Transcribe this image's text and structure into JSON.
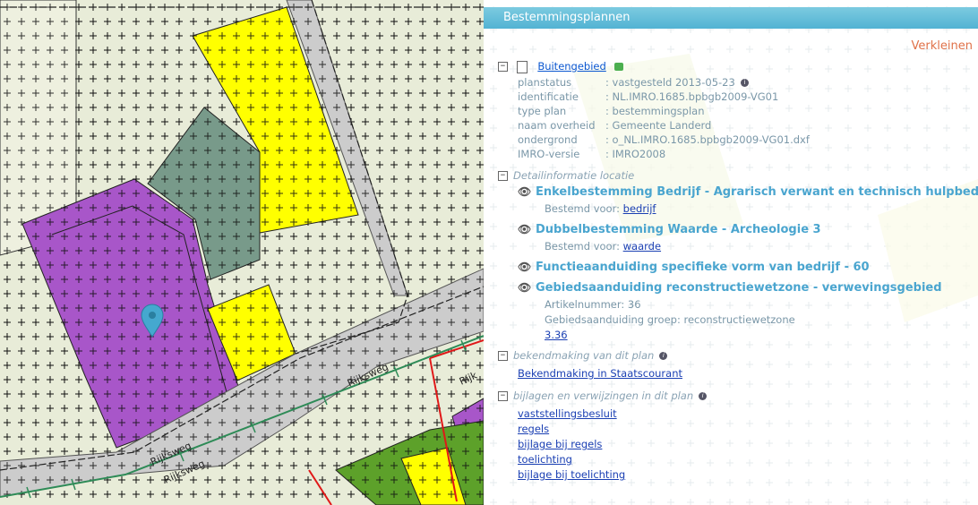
{
  "panel": {
    "title": "Bestemmingsplannen",
    "shrink_label": "Verkleinen",
    "plan": {
      "name": "Buitengebied",
      "fields": [
        {
          "key": "planstatus",
          "value": ": vastgesteld 2013-05-23"
        },
        {
          "key": "identificatie",
          "value": ": NL.IMRO.1685.bpbgb2009-VG01"
        },
        {
          "key": "type plan",
          "value": ": bestemmingsplan"
        },
        {
          "key": "naam overheid",
          "value": ": Gemeente Landerd"
        },
        {
          "key": "ondergrond",
          "value": ": o_NL.IMRO.1685.bpbgb2009-VG01.dxf"
        },
        {
          "key": "IMRO-versie",
          "value": ": IMRO2008"
        }
      ]
    },
    "detail": {
      "title": "Detailinformatie locatie",
      "items": [
        {
          "heading": "Enkelbestemming Bedrijf - Agrarisch verwant en technisch hulpbedrijf",
          "label": "Bestemd voor:",
          "link": "bedrijf"
        },
        {
          "heading": "Dubbelbestemming Waarde - Archeologie 3",
          "label": "Bestemd voor:",
          "link": "waarde"
        },
        {
          "heading": "Functieaanduiding specifieke vorm van bedrijf - 60"
        },
        {
          "heading": "Gebiedsaanduiding reconstructiewetzone - verwevingsgebied",
          "article": "Artikelnummer: 36",
          "group": "Gebiedsaanduiding groep: reconstructiewetzone",
          "link": "3.36"
        }
      ]
    },
    "bekendmaking": {
      "title": "bekendmaking van dit plan",
      "link": "Bekendmaking in Staatscourant"
    },
    "bijlagen": {
      "title": "bijlagen en verwijzingen in dit plan",
      "links": [
        "vaststellingsbesluit",
        "regels",
        "bijlage bij regels",
        "toelichting",
        "bijlage bij toelichting"
      ]
    }
  },
  "map": {
    "road_name": "Rijksweg",
    "colors": {
      "agrarisch": "#e8ecd8",
      "bedrijf": "#a856c9",
      "gemengd": "#ffff00",
      "groen": "#5da12a",
      "verkeer": "#cccccc",
      "grijsgroen": "#789a8a",
      "marker": "#45a8cf"
    }
  }
}
